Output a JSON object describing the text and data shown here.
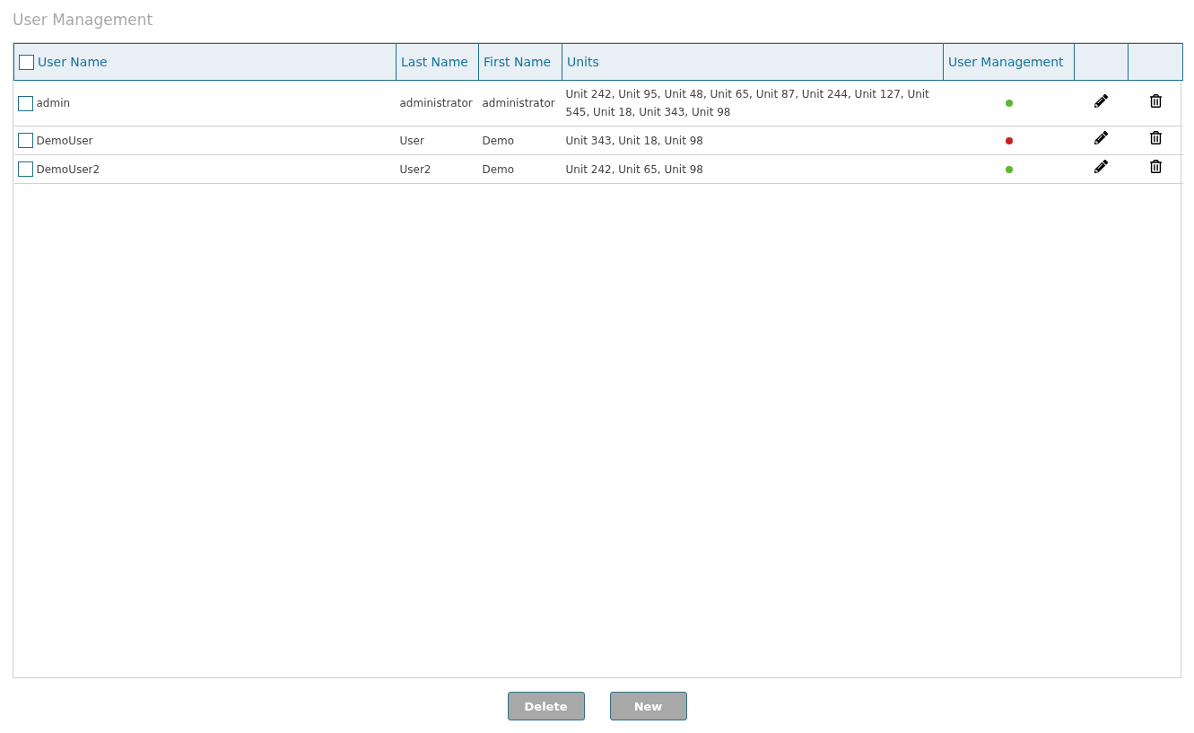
{
  "title": "User Management",
  "table": {
    "select_all": {
      "checked": false
    },
    "columns": [
      "User Name",
      "Last Name",
      "First Name",
      "Units",
      "User Management"
    ],
    "rows": [
      {
        "user_name": "admin",
        "last_name": "administrator",
        "first_name": "administrator",
        "units": "Unit 242, Unit 95, Unit 48, Unit 65, Unit 87, Unit 244, Unit 127, Unit 545, Unit 18, Unit 343, Unit 98",
        "checked": false,
        "color": "#5cb82e"
      },
      {
        "user_name": "DemoUser",
        "last_name": "User",
        "first_name": "Demo",
        "units": "Unit 343, Unit 18, Unit 98",
        "checked": false,
        "color": "#c8201a"
      },
      {
        "user_name": "DemoUser2",
        "last_name": "User2",
        "first_name": "Demo",
        "units": "Unit 242, Unit 65, Unit 98",
        "checked": false,
        "color": "#5cb82e"
      }
    ]
  },
  "buttons": [
    "Delete",
    "New"
  ]
}
